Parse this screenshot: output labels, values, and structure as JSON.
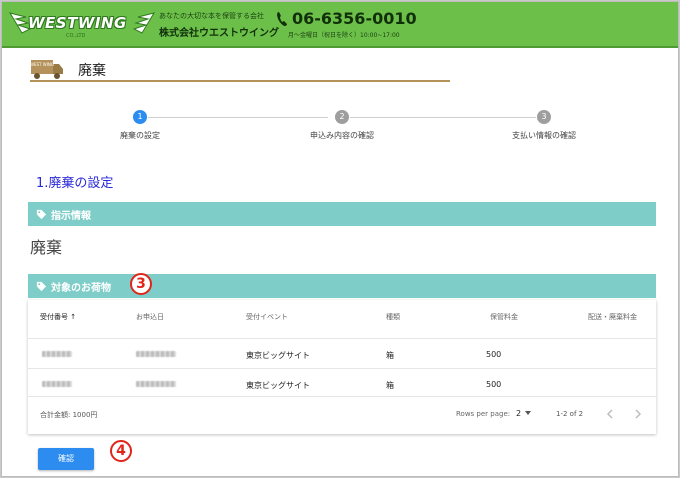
{
  "header": {
    "logo_text": "WESTWING",
    "logo_sub": "CO.,LTD",
    "company_tagline": "あなたの大切な本を保管する会社",
    "company_name": "株式会社ウエストウイング",
    "phone": "06-6356-0010",
    "hours": "月～金曜日（祝日を除く）10:00~17:00"
  },
  "page": {
    "title": "廃棄",
    "truck_label": "WEST WING"
  },
  "stepper": {
    "steps": [
      {
        "number": "1",
        "label": "廃棄の設定",
        "active": true
      },
      {
        "number": "2",
        "label": "申込み内容の確認",
        "active": false
      },
      {
        "number": "3",
        "label": "支払い情報の確認",
        "active": false
      }
    ]
  },
  "section_heading": "1.廃棄の設定",
  "instruction": {
    "bar_label": "指示情報",
    "value": "廃棄"
  },
  "items": {
    "bar_label": "対象のお荷物",
    "annotation": "3",
    "columns": [
      "受付番号",
      "お申込日",
      "受付イベント",
      "種類",
      "保管料金",
      "配送・廃棄料金"
    ],
    "sort_arrow": "↑",
    "rows": [
      {
        "event": "東京ビッグサイト",
        "type": "箱",
        "storage_fee": "500"
      },
      {
        "event": "東京ビッグサイト",
        "type": "箱",
        "storage_fee": "500"
      }
    ],
    "total": "合計金額: 1000円",
    "rows_per_page_label": "Rows per page:",
    "rows_per_page_value": "2",
    "range": "1-2 of 2"
  },
  "confirm_button": "確認",
  "confirm_annotation": "4",
  "colors": {
    "header_green": "#6cc04a",
    "teal_bar": "#7fcdc8",
    "accent_blue": "#2d8cf0",
    "heading_blue": "#2a2ad8",
    "annotation_red": "#e0261b"
  }
}
